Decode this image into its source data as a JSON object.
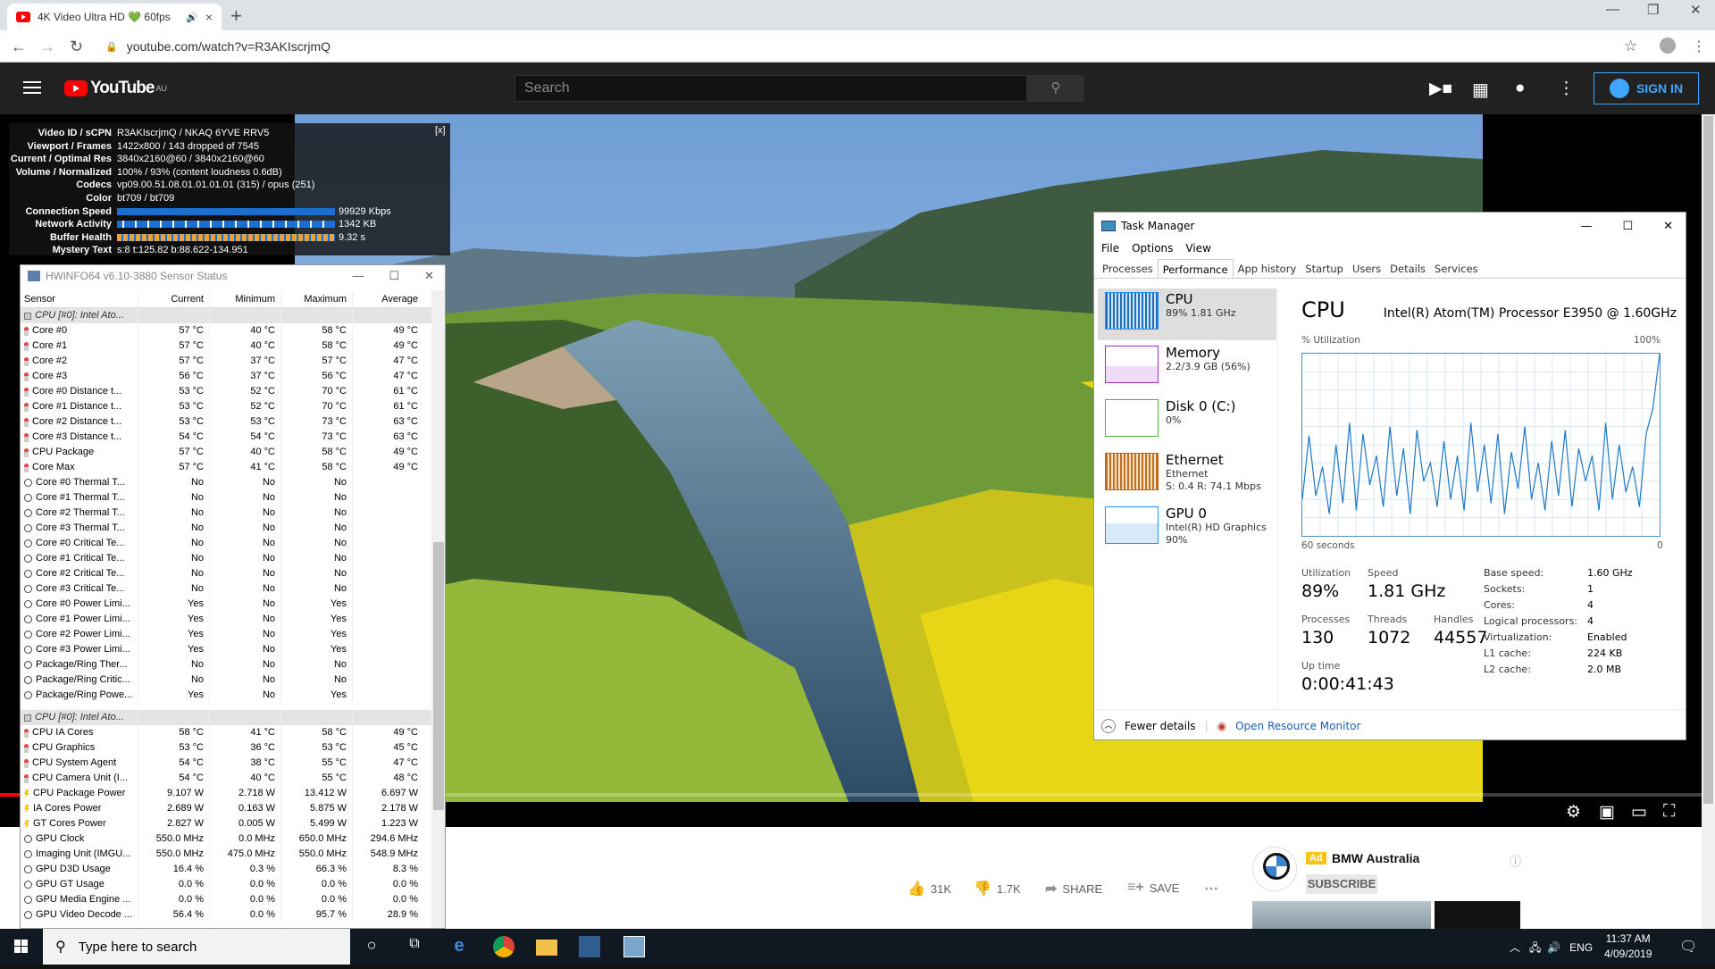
{
  "browser": {
    "tab_title": "4K Video Ultra HD 💚 60fps",
    "tab_close": "×",
    "new_tab": "+",
    "url": "youtube.com/watch?v=R3AKIscrjmQ",
    "win_minimize": "—",
    "win_restore": "❐",
    "win_close": "✕"
  },
  "youtube": {
    "logo_text": "YouTube",
    "region": "AU",
    "search_placeholder": "Search",
    "sign_in": "SIGN IN",
    "likes": "31K",
    "dislikes": "1.7K",
    "share": "SHARE",
    "save": "SAVE",
    "ad_label": "Ad",
    "ad_channel": "BMW Australia",
    "subscribe": "SUBSCRIBE",
    "progress_fraction": 0.012
  },
  "stats": {
    "close": "[x]",
    "rows": [
      {
        "k": "Video ID / sCPN",
        "v": "R3AKIscrjmQ / NKAQ 6YVE RRV5"
      },
      {
        "k": "Viewport / Frames",
        "v": "1422x800 / 143 dropped of 7545"
      },
      {
        "k": "Current / Optimal Res",
        "v": "3840x2160@60 / 3840x2160@60"
      },
      {
        "k": "Volume / Normalized",
        "v": "100% / 93% (content loudness 0.6dB)"
      },
      {
        "k": "Codecs",
        "v": "vp09.00.51.08.01.01.01.01 (315) / opus (251)"
      },
      {
        "k": "Color",
        "v": "bt709 / bt709"
      },
      {
        "k": "Connection Speed",
        "v": "99929 Kbps"
      },
      {
        "k": "Network Activity",
        "v": "1342 KB"
      },
      {
        "k": "Buffer Health",
        "v": "9.32 s"
      },
      {
        "k": "Mystery Text",
        "v": "s:8 t:125.82 b:88.622-134.951"
      }
    ]
  },
  "hwinfo": {
    "title": "HWiNFO64 v6.10-3880 Sensor Status",
    "headers": [
      "Sensor",
      "Current",
      "Minimum",
      "Maximum",
      "Average"
    ],
    "rows": [
      {
        "t": "grp",
        "n": "CPU [#0]: Intel Ato...",
        "c": "",
        "mi": "",
        "ma": "",
        "a": ""
      },
      {
        "t": "t",
        "n": "Core #0",
        "c": "57 °C",
        "mi": "40 °C",
        "ma": "58 °C",
        "a": "49 °C"
      },
      {
        "t": "t",
        "n": "Core #1",
        "c": "57 °C",
        "mi": "40 °C",
        "ma": "58 °C",
        "a": "49 °C"
      },
      {
        "t": "t",
        "n": "Core #2",
        "c": "57 °C",
        "mi": "37 °C",
        "ma": "57 °C",
        "a": "47 °C"
      },
      {
        "t": "t",
        "n": "Core #3",
        "c": "56 °C",
        "mi": "37 °C",
        "ma": "56 °C",
        "a": "47 °C"
      },
      {
        "t": "t",
        "n": "Core #0 Distance t...",
        "c": "53 °C",
        "mi": "52 °C",
        "ma": "70 °C",
        "a": "61 °C"
      },
      {
        "t": "t",
        "n": "Core #1 Distance t...",
        "c": "53 °C",
        "mi": "52 °C",
        "ma": "70 °C",
        "a": "61 °C"
      },
      {
        "t": "t",
        "n": "Core #2 Distance t...",
        "c": "53 °C",
        "mi": "53 °C",
        "ma": "73 °C",
        "a": "63 °C"
      },
      {
        "t": "t",
        "n": "Core #3 Distance t...",
        "c": "54 °C",
        "mi": "54 °C",
        "ma": "73 °C",
        "a": "63 °C"
      },
      {
        "t": "t",
        "n": "CPU Package",
        "c": "57 °C",
        "mi": "40 °C",
        "ma": "58 °C",
        "a": "49 °C"
      },
      {
        "t": "t",
        "n": "Core Max",
        "c": "57 °C",
        "mi": "41 °C",
        "ma": "58 °C",
        "a": "49 °C"
      },
      {
        "t": "n",
        "n": "Core #0 Thermal T...",
        "c": "No",
        "mi": "No",
        "ma": "No",
        "a": ""
      },
      {
        "t": "n",
        "n": "Core #1 Thermal T...",
        "c": "No",
        "mi": "No",
        "ma": "No",
        "a": ""
      },
      {
        "t": "n",
        "n": "Core #2 Thermal T...",
        "c": "No",
        "mi": "No",
        "ma": "No",
        "a": ""
      },
      {
        "t": "n",
        "n": "Core #3 Thermal T...",
        "c": "No",
        "mi": "No",
        "ma": "No",
        "a": ""
      },
      {
        "t": "n",
        "n": "Core #0 Critical Te...",
        "c": "No",
        "mi": "No",
        "ma": "No",
        "a": ""
      },
      {
        "t": "n",
        "n": "Core #1 Critical Te...",
        "c": "No",
        "mi": "No",
        "ma": "No",
        "a": ""
      },
      {
        "t": "n",
        "n": "Core #2 Critical Te...",
        "c": "No",
        "mi": "No",
        "ma": "No",
        "a": ""
      },
      {
        "t": "n",
        "n": "Core #3 Critical Te...",
        "c": "No",
        "mi": "No",
        "ma": "No",
        "a": ""
      },
      {
        "t": "n",
        "n": "Core #0 Power Limi...",
        "c": "Yes",
        "mi": "No",
        "ma": "Yes",
        "a": ""
      },
      {
        "t": "n",
        "n": "Core #1 Power Limi...",
        "c": "Yes",
        "mi": "No",
        "ma": "Yes",
        "a": ""
      },
      {
        "t": "n",
        "n": "Core #2 Power Limi...",
        "c": "Yes",
        "mi": "No",
        "ma": "Yes",
        "a": ""
      },
      {
        "t": "n",
        "n": "Core #3 Power Limi...",
        "c": "Yes",
        "mi": "No",
        "ma": "Yes",
        "a": ""
      },
      {
        "t": "n",
        "n": "Package/Ring Ther...",
        "c": "No",
        "mi": "No",
        "ma": "No",
        "a": ""
      },
      {
        "t": "n",
        "n": "Package/Ring Critic...",
        "c": "No",
        "mi": "No",
        "ma": "No",
        "a": ""
      },
      {
        "t": "n",
        "n": "Package/Ring Powe...",
        "c": "Yes",
        "mi": "No",
        "ma": "Yes",
        "a": ""
      },
      {
        "t": "gap",
        "n": "",
        "c": "",
        "mi": "",
        "ma": "",
        "a": ""
      },
      {
        "t": "grp",
        "n": "CPU [#0]: Intel Ato...",
        "c": "",
        "mi": "",
        "ma": "",
        "a": ""
      },
      {
        "t": "t",
        "n": "CPU IA Cores",
        "c": "58 °C",
        "mi": "41 °C",
        "ma": "58 °C",
        "a": "49 °C"
      },
      {
        "t": "t",
        "n": "CPU Graphics",
        "c": "53 °C",
        "mi": "36 °C",
        "ma": "53 °C",
        "a": "45 °C"
      },
      {
        "t": "t",
        "n": "CPU System Agent",
        "c": "54 °C",
        "mi": "38 °C",
        "ma": "55 °C",
        "a": "47 °C"
      },
      {
        "t": "t",
        "n": "CPU Camera Unit (I...",
        "c": "54 °C",
        "mi": "40 °C",
        "ma": "55 °C",
        "a": "48 °C"
      },
      {
        "t": "p",
        "n": "CPU Package Power",
        "c": "9.107 W",
        "mi": "2.718 W",
        "ma": "13.412 W",
        "a": "6.697 W"
      },
      {
        "t": "p",
        "n": "IA Cores Power",
        "c": "2.689 W",
        "mi": "0.163 W",
        "ma": "5.875 W",
        "a": "2.178 W"
      },
      {
        "t": "p",
        "n": "GT Cores Power",
        "c": "2.827 W",
        "mi": "0.005 W",
        "ma": "5.499 W",
        "a": "1.223 W"
      },
      {
        "t": "n",
        "n": "GPU Clock",
        "c": "550.0 MHz",
        "mi": "0.0 MHz",
        "ma": "650.0 MHz",
        "a": "294.6 MHz"
      },
      {
        "t": "n",
        "n": "Imaging Unit (IMGU...",
        "c": "550.0 MHz",
        "mi": "475.0 MHz",
        "ma": "550.0 MHz",
        "a": "548.9 MHz"
      },
      {
        "t": "n",
        "n": "GPU D3D Usage",
        "c": "16.4 %",
        "mi": "0.3 %",
        "ma": "66.3 %",
        "a": "8.3 %"
      },
      {
        "t": "n",
        "n": "GPU GT Usage",
        "c": "0.0 %",
        "mi": "0.0 %",
        "ma": "0.0 %",
        "a": "0.0 %"
      },
      {
        "t": "n",
        "n": "GPU Media Engine ...",
        "c": "0.0 %",
        "mi": "0.0 %",
        "ma": "0.0 %",
        "a": "0.0 %"
      },
      {
        "t": "n",
        "n": "GPU Video Decode ...",
        "c": "56.4 %",
        "mi": "0.0 %",
        "ma": "95.7 %",
        "a": "28.9 %"
      }
    ]
  },
  "taskmgr": {
    "title": "Task Manager",
    "menu": [
      "File",
      "Options",
      "View"
    ],
    "tabs": [
      "Processes",
      "Performance",
      "App history",
      "Startup",
      "Users",
      "Details",
      "Services"
    ],
    "resources": [
      {
        "name": "CPU",
        "sub1": "89% 1.81 GHz",
        "sub2": "",
        "sub3": ""
      },
      {
        "name": "Memory",
        "sub1": "2.2/3.9 GB (56%)",
        "sub2": "",
        "sub3": ""
      },
      {
        "name": "Disk 0 (C:)",
        "sub1": "0%",
        "sub2": "",
        "sub3": ""
      },
      {
        "name": "Ethernet",
        "sub1": "Ethernet",
        "sub2": "S: 0.4  R: 74.1 Mbps",
        "sub3": ""
      },
      {
        "name": "GPU 0",
        "sub1": "Intel(R) HD Graphics",
        "sub2": "90%",
        "sub3": ""
      }
    ],
    "cpu_title": "CPU",
    "cpu_name": "Intel(R) Atom(TM) Processor E3950 @ 1.60GHz",
    "util_label": "% Utilization",
    "max_label": "100%",
    "time_label": "60 seconds",
    "zero_label": "0",
    "utilization_label": "Utilization",
    "utilization": "89%",
    "speed_label": "Speed",
    "speed": "1.81 GHz",
    "processes_label": "Processes",
    "processes": "130",
    "threads_label": "Threads",
    "threads": "1072",
    "handles_label": "Handles",
    "handles": "44557",
    "uptime_label": "Up time",
    "uptime": "0:00:41:43",
    "specs": [
      {
        "k": "Base speed:",
        "v": "1.60 GHz"
      },
      {
        "k": "Sockets:",
        "v": "1"
      },
      {
        "k": "Cores:",
        "v": "4"
      },
      {
        "k": "Logical processors:",
        "v": "4"
      },
      {
        "k": "Virtualization:",
        "v": "Enabled"
      },
      {
        "k": "L1 cache:",
        "v": "224 KB"
      },
      {
        "k": "L2 cache:",
        "v": "2.0 MB"
      }
    ],
    "fewer_details": "Fewer details",
    "open_monitor": "Open Resource Monitor",
    "cpu_history": [
      20,
      55,
      22,
      38,
      12,
      50,
      18,
      62,
      14,
      56,
      28,
      44,
      16,
      60,
      22,
      48,
      12,
      58,
      30,
      40,
      16,
      52,
      20,
      44,
      14,
      62,
      24,
      50,
      18,
      56,
      12,
      46,
      26,
      60,
      20,
      40,
      14,
      52,
      22,
      58,
      16,
      48,
      30,
      44,
      14,
      62,
      20,
      50,
      24,
      38,
      16,
      56,
      70,
      100
    ]
  },
  "taskbar": {
    "search_placeholder": "Type here to search",
    "language": "ENG",
    "time": "11:37 AM",
    "date": "4/09/2019"
  }
}
